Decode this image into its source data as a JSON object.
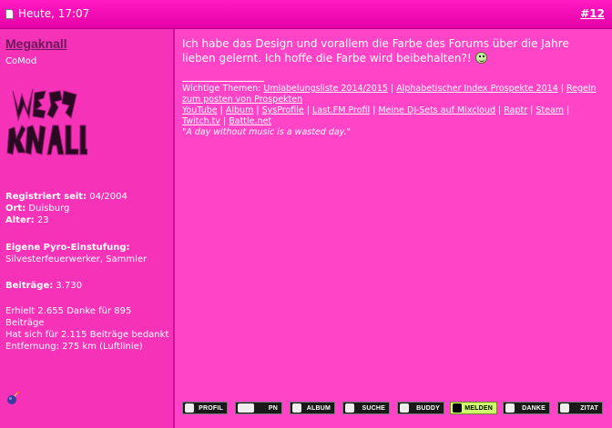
{
  "topbar": {
    "date": "Heute, 17:07",
    "post_number": "#12"
  },
  "user": {
    "name": "Megaknall",
    "title": "CoMod",
    "registered_label": "Registriert seit:",
    "registered_value": "04/2004",
    "location_label": "Ort:",
    "location_value": "Duisburg",
    "age_label": "Alter:",
    "age_value": "23",
    "rating_label": "Eigene Pyro-Einstufung:",
    "rating_value": "Silvesterfeuerwerker, Sammler",
    "posts_label": "Beiträge:",
    "posts_value": "3.730",
    "thanks_received": "Erhielt 2.655 Danke für 895 Beiträge",
    "thanks_given": "Hat sich für 2.115 Beiträge bedankt",
    "distance": "Entfernung: 275 km (Luftlinie)"
  },
  "post": {
    "message": "Ich habe das Design und vorallem die Farbe des Forums über die Jahre lieben gelernt. Ich hoffe die Farbe wird beibehalten?!"
  },
  "signature": {
    "themes_label": "Wichtige Themen:",
    "link1": "Umlabelungsliste 2014/2015",
    "link2": "Alphabetischer Index Prospekte 2014",
    "link3": "Regeln zum posten von Prospekten",
    "link4": "YouTube",
    "link5": "Album",
    "link6": "SysProfile",
    "link7": "Last.FM Profil",
    "link8": "Meine DJ-Sets auf Mixcloud",
    "link9": "Raptr",
    "link10": "Steam",
    "link11": "Twitch.tv",
    "link12": "Battle.net",
    "quote": "\"A day without music is a wasted day.\""
  },
  "buttons": {
    "profil": "PROFIL",
    "pn": "PN",
    "album": "ALBUM",
    "suche": "SUCHE",
    "buddy": "BUDDY",
    "melden": "MELDEN",
    "danke": "DANKE",
    "zitat": "ZITAT"
  },
  "colors": {
    "header": "#e600a8",
    "sidebar": "#f532b8",
    "content": "#ff44c8",
    "username": "#6a1a5a",
    "melden_button": "#cfff6a"
  },
  "icons": {
    "post": "document-icon",
    "avatar": "megaknall-logo",
    "sidebar_bottom": "bomb-icon",
    "smiley": "smiley-icon"
  }
}
